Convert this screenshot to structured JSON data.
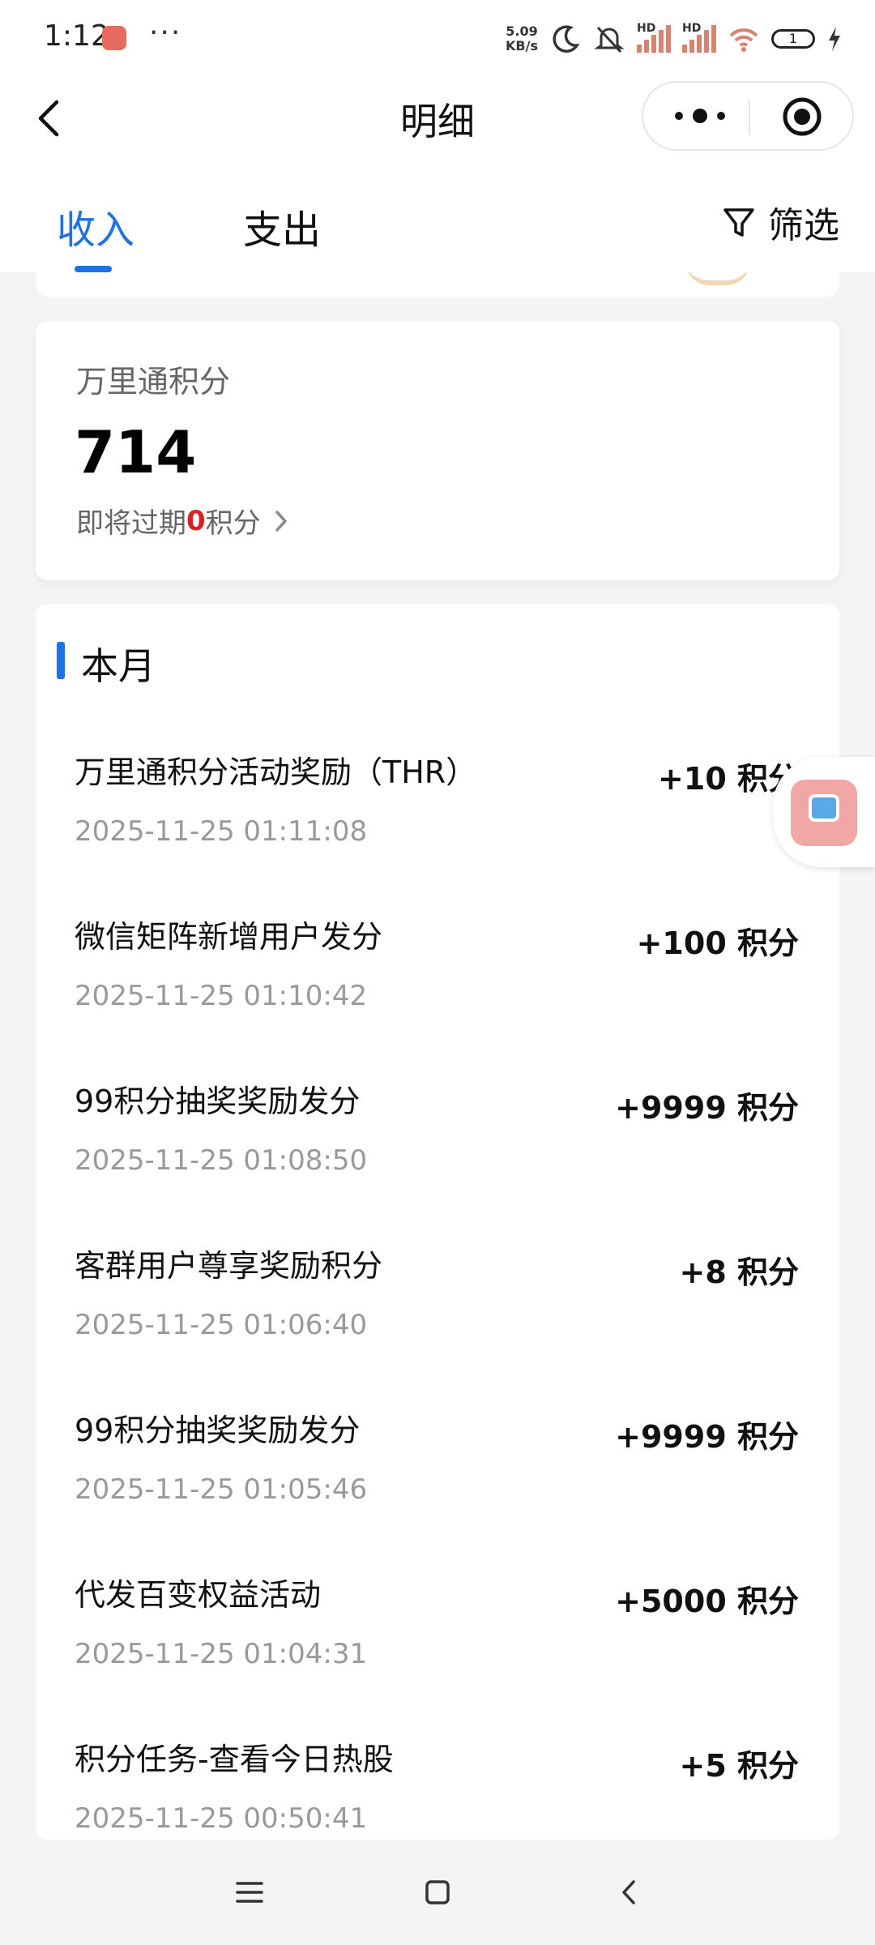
{
  "status_bar": {
    "time": "1:12",
    "more": "···",
    "net_speed_value": "5.09",
    "net_speed_unit": "KB/s",
    "signal_label_1": "HD",
    "signal_label_2": "HD",
    "battery": "1",
    "icons": [
      "app-notification-icon",
      "moon-icon",
      "bell-muted-icon",
      "signal-icon",
      "signal-icon",
      "wifi-icon",
      "battery-icon",
      "charging-icon"
    ]
  },
  "title_bar": {
    "title": "明细"
  },
  "tabs": {
    "income": "收入",
    "expense": "支出",
    "active": "income",
    "filter_label": "筛选"
  },
  "points": {
    "label": "万里通积分",
    "value": "714",
    "expire_prefix": "即将过期",
    "expire_value": "0",
    "expire_suffix": "积分"
  },
  "section": {
    "title": "本月"
  },
  "records": [
    {
      "title": "万里通积分活动奖励（THR）",
      "time": "2025-11-25 01:11:08",
      "amount": "+10 积分"
    },
    {
      "title": "微信矩阵新增用户发分",
      "time": "2025-11-25 01:10:42",
      "amount": "+100 积分"
    },
    {
      "title": "99积分抽奖奖励发分",
      "time": "2025-11-25 01:08:50",
      "amount": "+9999 积分"
    },
    {
      "title": "客群用户尊享奖励积分",
      "time": "2025-11-25 01:06:40",
      "amount": "+8 积分"
    },
    {
      "title": "99积分抽奖奖励发分",
      "time": "2025-11-25 01:05:46",
      "amount": "+9999 积分"
    },
    {
      "title": "代发百变权益活动",
      "time": "2025-11-25 01:04:31",
      "amount": "+5000 积分"
    },
    {
      "title": "积分任务-查看今日热股",
      "time": "2025-11-25 00:50:41",
      "amount": "+5 积分"
    }
  ],
  "colors": {
    "accent": "#1a73e8",
    "expire_highlight": "#e02020",
    "background": "#f4f4f6"
  }
}
